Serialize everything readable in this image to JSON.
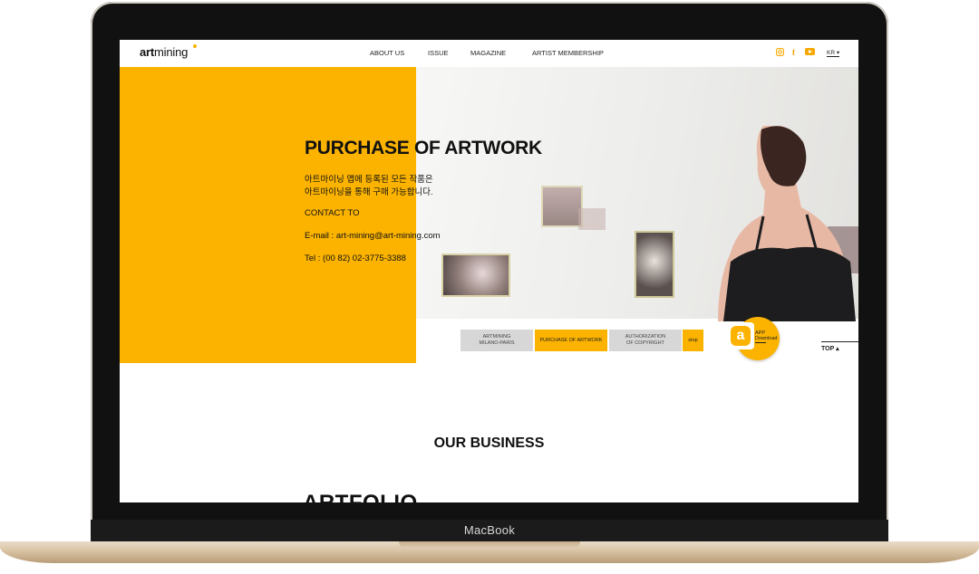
{
  "device": {
    "label": "MacBook"
  },
  "header": {
    "logo_bold": "art",
    "logo_thin": "mining",
    "nav": [
      "ABOUT US",
      "ISSUE",
      "MAGAZINE",
      "ARTIST MEMBERSHIP"
    ],
    "social": [
      "instagram-icon",
      "facebook-icon",
      "youtube-icon"
    ],
    "lang": "KR ▾"
  },
  "hero": {
    "title": "PURCHASE OF ARTWORK",
    "line1": "아트마이닝 앱에 등록된 모든 작품은",
    "line2": "아트마이닝을 통해 구매 가능합니다.",
    "contact": "CONTACT TO",
    "email": "E-mail : art-mining@art-mining.com",
    "tel": "Tel : (00 82) 02-3775-3388"
  },
  "tabs": [
    {
      "line1": "ARTMINING",
      "line2": "MILANO-PARIS"
    },
    {
      "line1": "PURCHASE OF ARTWORK",
      "line2": ""
    },
    {
      "line1": "AUTHORIZATION",
      "line2": "OF COPYRIGHT"
    },
    {
      "line1": "stop",
      "line2": ""
    }
  ],
  "app": {
    "letter": "a",
    "line1": "APP",
    "line2": "Download"
  },
  "top_button": "TOP ▴",
  "section": {
    "title": "OUR BUSINESS",
    "next_title": "ARTFOLIO"
  },
  "colors": {
    "accent": "#fbb300"
  }
}
